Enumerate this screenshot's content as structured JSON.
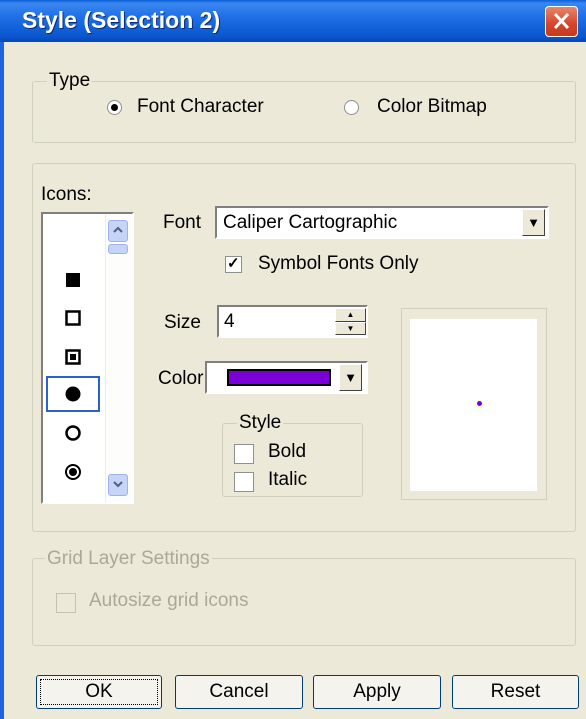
{
  "window": {
    "title": "Style (Selection 2)"
  },
  "type_group": {
    "legend": "Type",
    "options": [
      {
        "label": "Font Character",
        "selected": true
      },
      {
        "label": "Color Bitmap",
        "selected": false
      }
    ]
  },
  "icons": {
    "label": "Icons:",
    "items": [
      "filled-square-icon",
      "hollow-square-icon",
      "boxed-square-icon",
      "filled-circle-icon",
      "hollow-circle-icon",
      "bullseye-circle-icon"
    ],
    "selected_index": 3
  },
  "font": {
    "label": "Font",
    "value": "Caliper Cartographic"
  },
  "symbol_fonts_only": {
    "label": "Symbol Fonts Only",
    "checked": true
  },
  "size": {
    "label": "Size",
    "value": "4"
  },
  "color": {
    "label": "Color",
    "value": "#7b00d8"
  },
  "style_group": {
    "legend": "Style",
    "bold": {
      "label": "Bold",
      "checked": false
    },
    "italic": {
      "label": "Italic",
      "checked": false
    }
  },
  "grid_layer": {
    "legend": "Grid Layer Settings",
    "autosize": {
      "label": "Autosize grid icons",
      "checked": false
    }
  },
  "buttons": {
    "ok": "OK",
    "cancel": "Cancel",
    "apply": "Apply",
    "reset": "Reset"
  }
}
